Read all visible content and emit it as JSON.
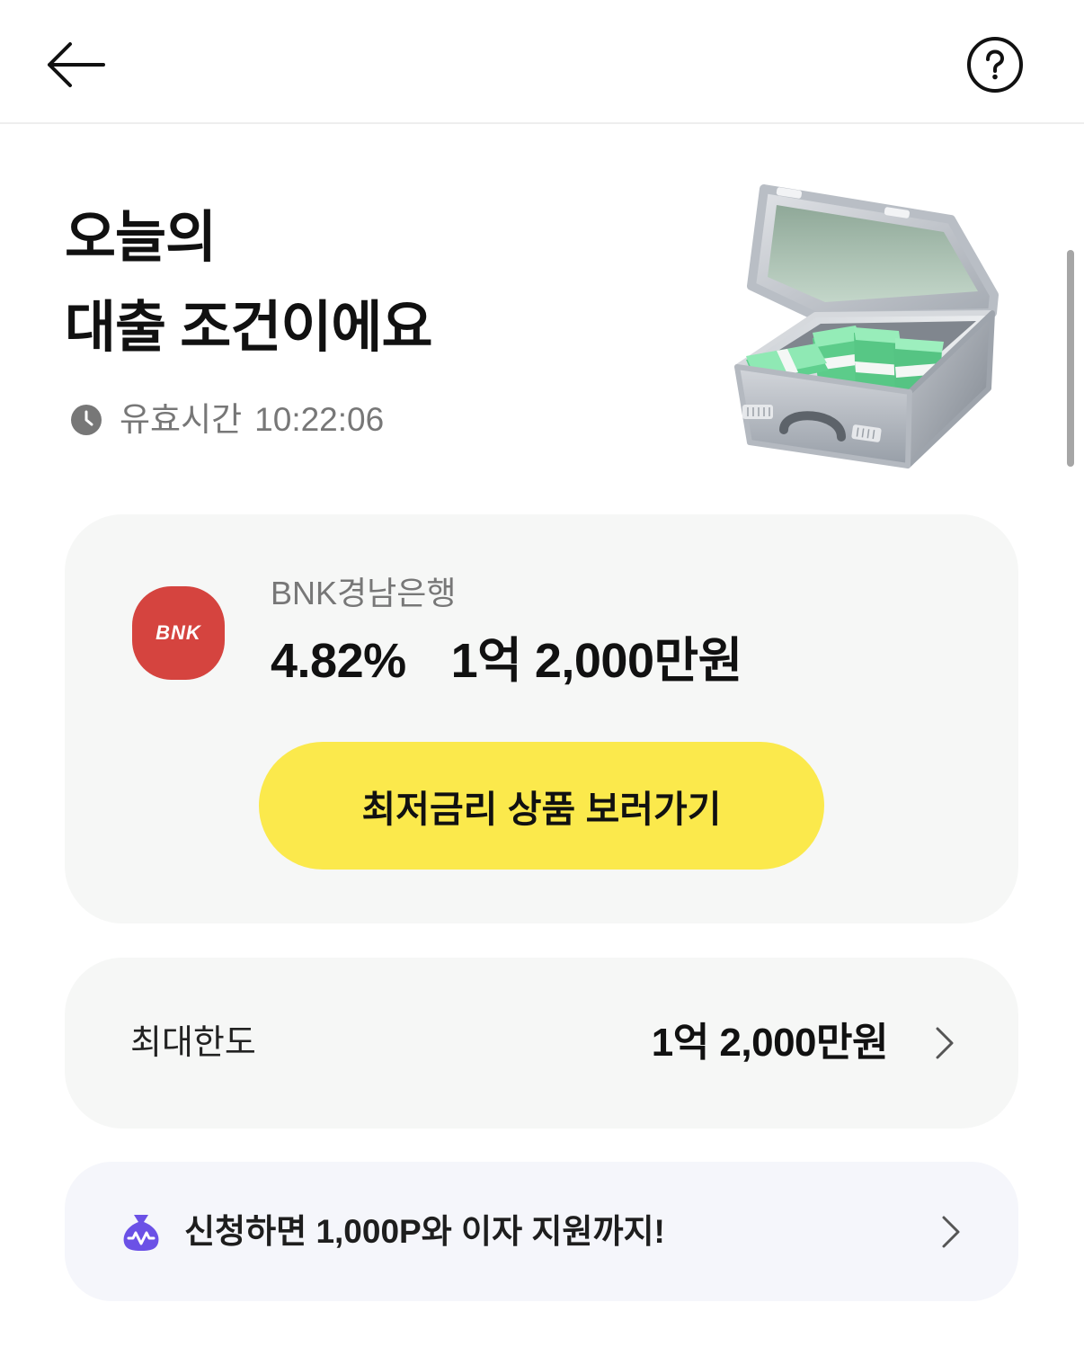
{
  "colors": {
    "accent": "#fbe94c",
    "bank_brand": "#d5443f",
    "card_background": "#f6f7f6",
    "promo_background": "#f5f6fb",
    "promo_icon": "#6b51e6",
    "text_primary": "#111111",
    "text_secondary": "#777777"
  },
  "header": {
    "back_icon": "arrow-left-icon",
    "help_icon": "question-circle-icon"
  },
  "title": {
    "line1": "오늘의",
    "line2": "대출 조건이에요"
  },
  "validity": {
    "icon": "clock-icon",
    "label": "유효시간",
    "time": "10:22:06"
  },
  "illustration": {
    "icon": "open-briefcase-money-icon"
  },
  "offer": {
    "bank_logo_icon": "bnk-logo-icon",
    "bank_logo_text": "BNK",
    "bank_name": "BNK경남은행",
    "rate": "4.82%",
    "amount": "1억 2,000만원",
    "cta_label": "최저금리 상품 보러가기"
  },
  "limit": {
    "label": "최대한도",
    "value": "1억 2,000만원",
    "chevron_icon": "chevron-right-icon"
  },
  "promo": {
    "icon": "money-bag-icon",
    "text": "신청하면 1,000P와 이자 지원까지!",
    "chevron_icon": "chevron-right-icon"
  }
}
